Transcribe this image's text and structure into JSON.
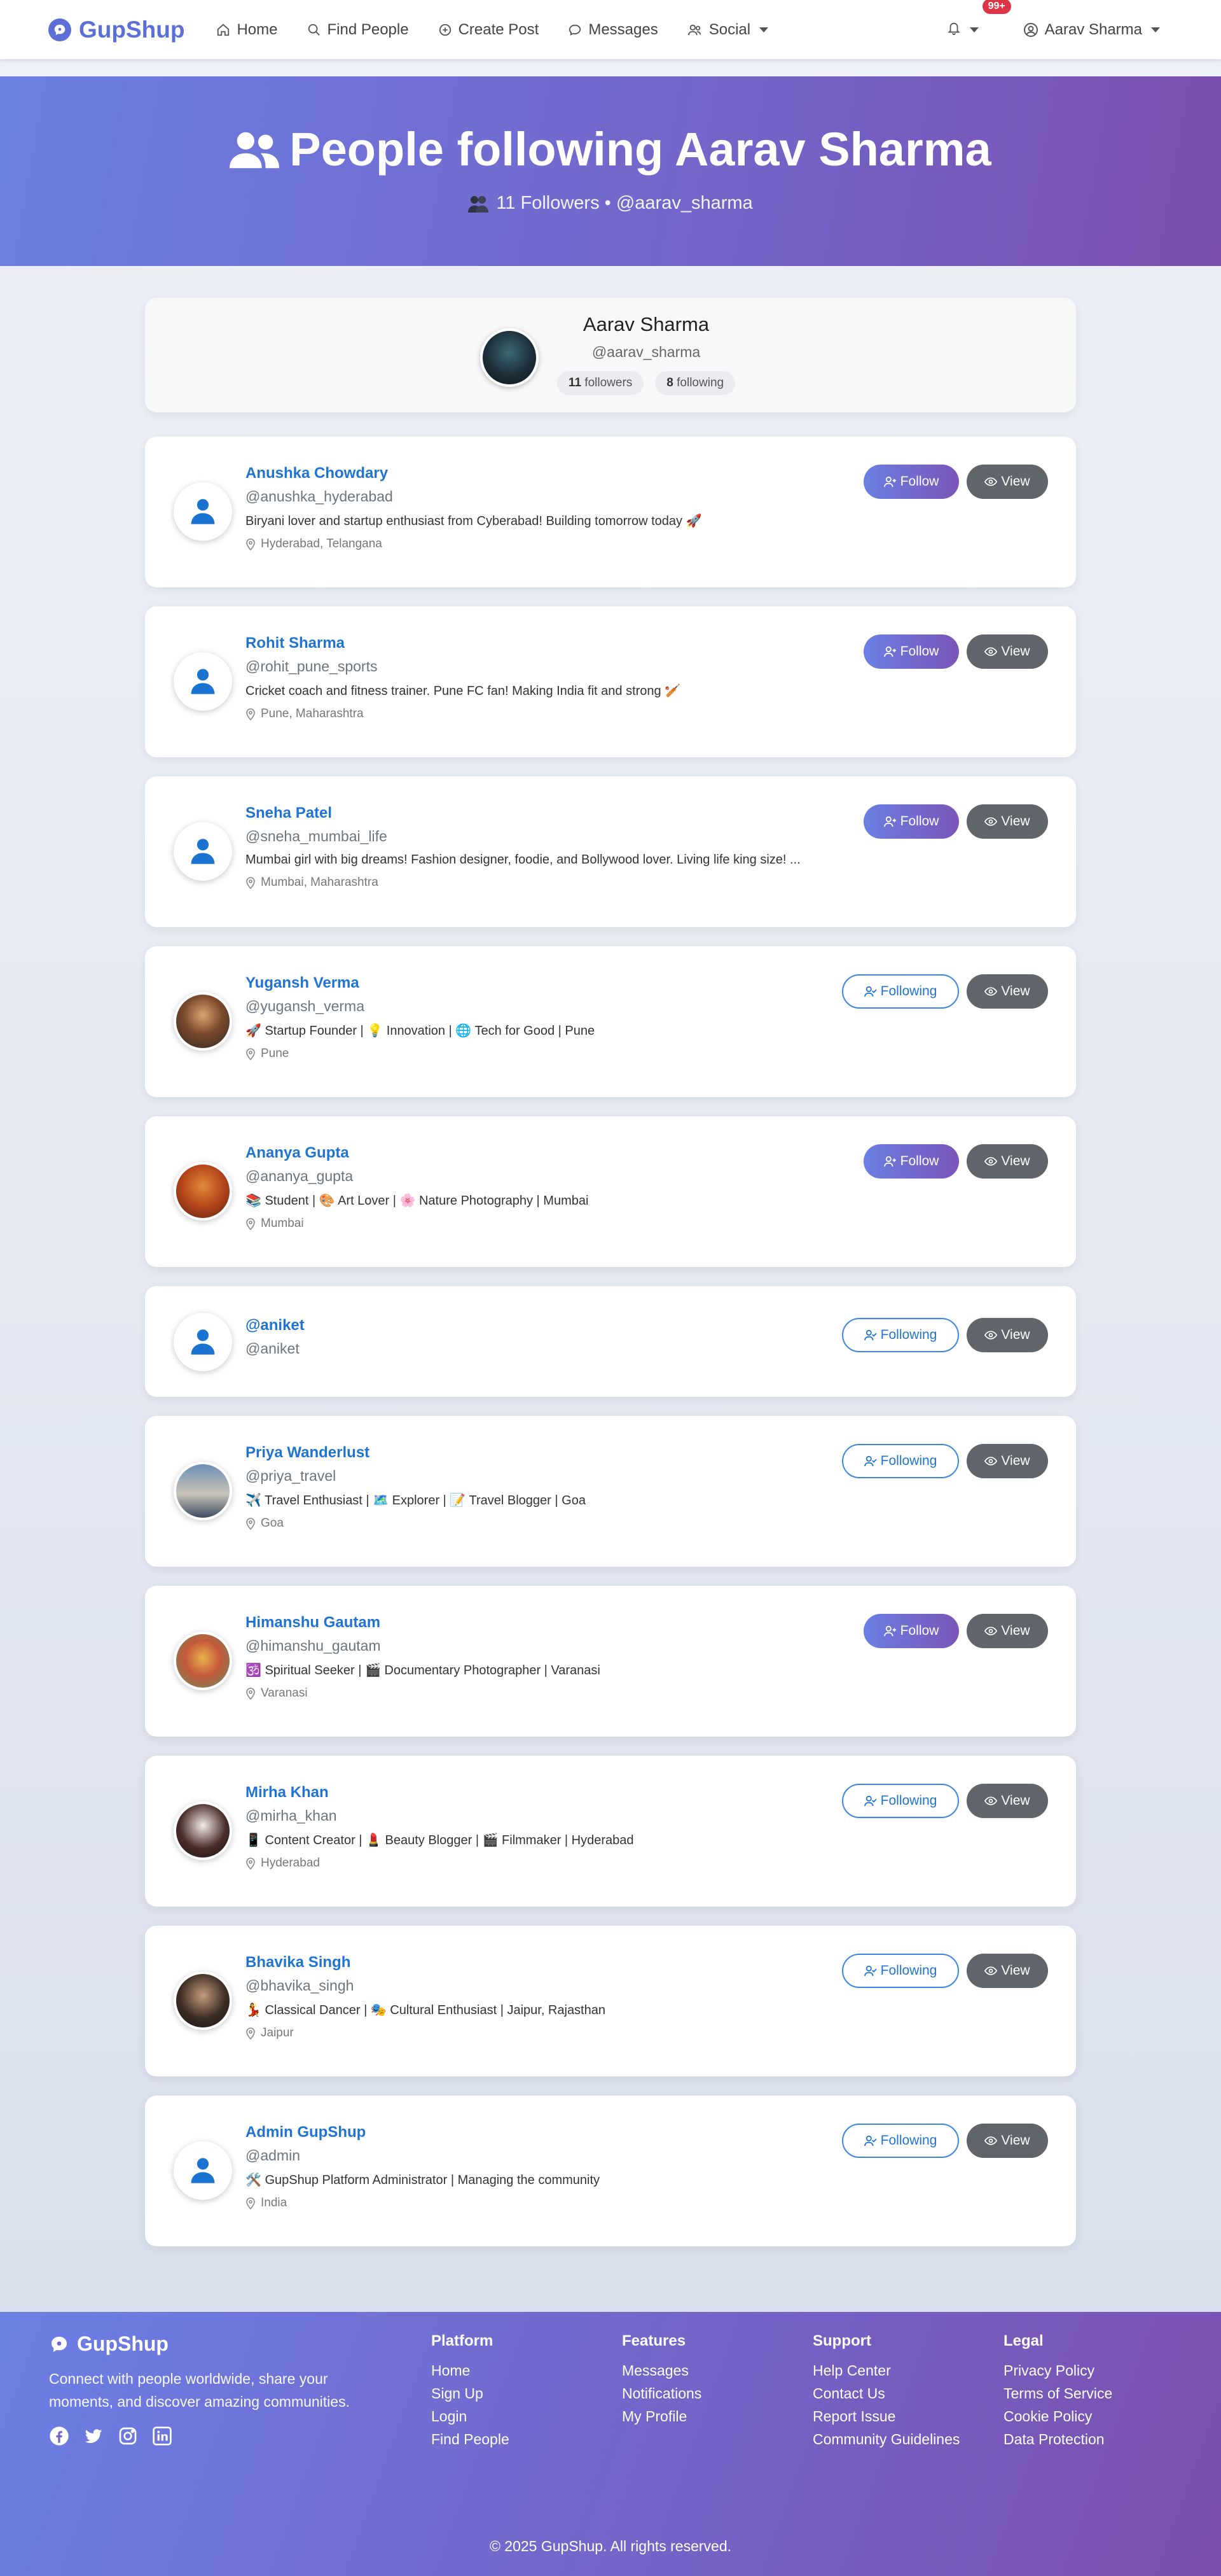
{
  "nav": {
    "brand": "GupShup",
    "links": [
      {
        "label": "Home",
        "icon": "home-icon"
      },
      {
        "label": "Find People",
        "icon": "search-icon"
      },
      {
        "label": "Create Post",
        "icon": "plus-circle-icon"
      },
      {
        "label": "Messages",
        "icon": "chat-icon"
      },
      {
        "label": "Social",
        "icon": "users-icon"
      }
    ],
    "notification_badge": "99+",
    "user": "Aarav Sharma"
  },
  "hero": {
    "title": "People following Aarav Sharma",
    "subtitle": "11 Followers • @aarav_sharma"
  },
  "profile": {
    "name": "Aarav Sharma",
    "handle": "@aarav_sharma",
    "followers_count": "11",
    "followers_label": "followers",
    "following_count": "8",
    "following_label": "following"
  },
  "buttons": {
    "follow": "Follow",
    "following": "Following",
    "view": "View"
  },
  "followers": [
    {
      "name": "Anushka Chowdary",
      "handle": "@anushka_hyderabad",
      "bio": "Biryani lover and startup enthusiast from Cyberabad! Building tomorrow today 🚀",
      "location": "Hyderabad, Telangana",
      "status": "follow"
    },
    {
      "name": "Rohit Sharma",
      "handle": "@rohit_pune_sports",
      "bio": "Cricket coach and fitness trainer. Pune FC fan! Making India fit and strong 🏏",
      "location": "Pune, Maharashtra",
      "status": "follow"
    },
    {
      "name": "Sneha Patel",
      "handle": "@sneha_mumbai_life",
      "bio": "Mumbai girl with big dreams! Fashion designer, foodie, and Bollywood lover. Living life king size! ...",
      "location": "Mumbai, Maharashtra",
      "status": "follow"
    },
    {
      "name": "Yugansh Verma",
      "handle": "@yugansh_verma",
      "bio": "🚀 Startup Founder | 💡 Innovation | 🌐 Tech for Good | Pune",
      "location": "Pune",
      "status": "following"
    },
    {
      "name": "Ananya Gupta",
      "handle": "@ananya_gupta",
      "bio": "📚 Student | 🎨 Art Lover | 🌸 Nature Photography | Mumbai",
      "location": "Mumbai",
      "status": "follow"
    },
    {
      "name": "@aniket",
      "handle": "@aniket",
      "bio": "",
      "location": "",
      "status": "following"
    },
    {
      "name": "Priya Wanderlust",
      "handle": "@priya_travel",
      "bio": "✈️ Travel Enthusiast | 🗺️ Explorer | 📝 Travel Blogger | Goa",
      "location": "Goa",
      "status": "following"
    },
    {
      "name": "Himanshu Gautam",
      "handle": "@himanshu_gautam",
      "bio": "🕉️ Spiritual Seeker | 🎬 Documentary Photographer | Varanasi",
      "location": "Varanasi",
      "status": "follow"
    },
    {
      "name": "Mirha Khan",
      "handle": "@mirha_khan",
      "bio": "📱 Content Creator | 💄 Beauty Blogger | 🎬 Filmmaker | Hyderabad",
      "location": "Hyderabad",
      "status": "following"
    },
    {
      "name": "Bhavika Singh",
      "handle": "@bhavika_singh",
      "bio": "💃 Classical Dancer | 🎭 Cultural Enthusiast | Jaipur, Rajasthan",
      "location": "Jaipur",
      "status": "following"
    },
    {
      "name": "Admin GupShup",
      "handle": "@admin",
      "bio": "🛠️ GupShup Platform Administrator | Managing the community",
      "location": "India",
      "status": "following"
    }
  ],
  "footer": {
    "brand": "GupShup",
    "description": "Connect with people worldwide, share your moments, and discover amazing communities.",
    "social_icons": [
      "facebook-icon",
      "twitter-icon",
      "instagram-icon",
      "linkedin-icon"
    ],
    "columns": [
      {
        "title": "Platform",
        "links": [
          "Home",
          "Sign Up",
          "Login",
          "Find People"
        ]
      },
      {
        "title": "Features",
        "links": [
          "Messages",
          "Notifications",
          "My Profile"
        ]
      },
      {
        "title": "Support",
        "links": [
          "Help Center",
          "Contact Us",
          "Report Issue",
          "Community Guidelines"
        ]
      },
      {
        "title": "Legal",
        "links": [
          "Privacy Policy",
          "Terms of Service",
          "Cookie Policy",
          "Data Protection"
        ]
      }
    ],
    "copyright": "© 2025 GupShup. All rights reserved."
  },
  "colors": {
    "brand": "#5b6fd6",
    "hero_start": "#6b7fe3",
    "hero_end": "#7a4fae",
    "link_blue": "#1f74d3",
    "badge_red": "#dc3545",
    "view_button": "#5f656b"
  }
}
